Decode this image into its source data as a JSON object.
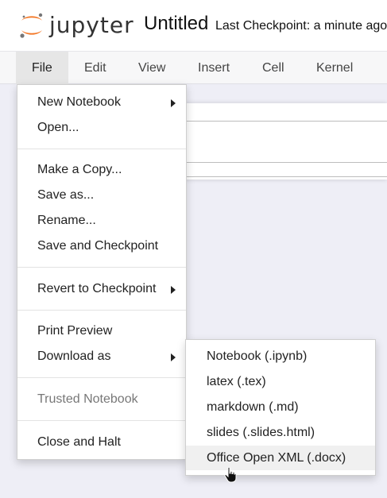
{
  "header": {
    "brand": "jupyter",
    "notebook_title": "Untitled",
    "checkpoint": "Last Checkpoint: a minute ago"
  },
  "menubar": {
    "items": [
      {
        "label": "File",
        "active": true
      },
      {
        "label": "Edit"
      },
      {
        "label": "View"
      },
      {
        "label": "Insert"
      },
      {
        "label": "Cell"
      },
      {
        "label": "Kernel"
      }
    ]
  },
  "file_menu": {
    "new_notebook": "New Notebook",
    "open": "Open...",
    "make_copy": "Make a Copy...",
    "save_as": "Save as...",
    "rename": "Rename...",
    "save_checkpoint": "Save and Checkpoint",
    "revert": "Revert to Checkpoint",
    "print_preview": "Print Preview",
    "download_as": "Download as",
    "trusted": "Trusted Notebook",
    "close_halt": "Close and Halt"
  },
  "download_submenu": {
    "items": [
      "Notebook (.ipynb)",
      "latex (.tex)",
      "markdown (.md)",
      "slides (.slides.html)",
      "Office Open XML (.docx)"
    ],
    "hovered": "Office Open XML (.docx)"
  },
  "icons": {
    "logo": "jupyter-logo",
    "submenu_arrow": "caret-right-icon",
    "cursor": "hand-pointer-icon"
  },
  "colors": {
    "logo_orange": "#F37726",
    "logo_gray": "#767677",
    "page_background": "#eeeef6",
    "menu_active": "#e6e6e6"
  }
}
